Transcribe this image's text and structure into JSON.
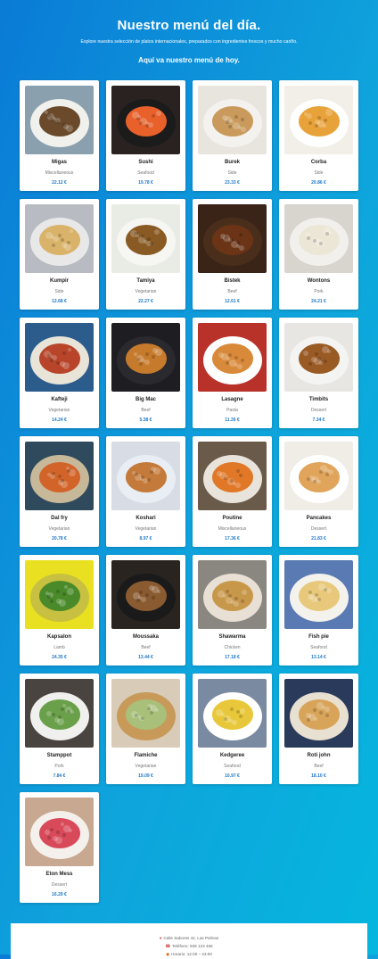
{
  "header": {
    "title": "Nuestro menú del día.",
    "subtitle": "Explore nuestra selección de platos internacionales, preparados con ingredientes frescos y mucho cariño.",
    "intro": "Aquí va nuestro menú de hoy."
  },
  "menu": [
    {
      "name": "Migas",
      "category": "Miscellaneous",
      "price": "22.12 €",
      "icon": "migas-dish-photo",
      "bg": "#8aa0ae",
      "plate": "#f0f0ec",
      "food": "#6a4a2a"
    },
    {
      "name": "Sushi",
      "category": "Seafood",
      "price": "19.78 €",
      "icon": "sushi-photo",
      "bg": "#2a2220",
      "plate": "#1b1b1b",
      "food": "#e8602a"
    },
    {
      "name": "Burek",
      "category": "Side",
      "price": "23.33 €",
      "icon": "burek-photo",
      "bg": "#e8e4de",
      "plate": "#f4f2ee",
      "food": "#c99a5c"
    },
    {
      "name": "Corba",
      "category": "Side",
      "price": "20.86 €",
      "icon": "corba-soup-photo",
      "bg": "#f2eee8",
      "plate": "#ffffff",
      "food": "#e8a23a"
    },
    {
      "name": "Kumpir",
      "category": "Side",
      "price": "12.68 €",
      "icon": "kumpir-photo",
      "bg": "#b8bcc2",
      "plate": "#e8e8e8",
      "food": "#d9b36a"
    },
    {
      "name": "Tamiya",
      "category": "Vegetarian",
      "price": "22.27 €",
      "icon": "tamiya-photo",
      "bg": "#e9ece4",
      "plate": "#f6f6f2",
      "food": "#8a5a24"
    },
    {
      "name": "Bistek",
      "category": "Beef",
      "price": "12.61 €",
      "icon": "bistek-photo",
      "bg": "#3a2418",
      "plate": "#4a2e1c",
      "food": "#6b3416"
    },
    {
      "name": "Wontons",
      "category": "Pork",
      "price": "24.21 €",
      "icon": "wontons-photo",
      "bg": "#d8d4ce",
      "plate": "#f2f0ec",
      "food": "#ece6d6"
    },
    {
      "name": "Kafteji",
      "category": "Vegetarian",
      "price": "14.24 €",
      "icon": "kafteji-photo",
      "bg": "#2b5c8c",
      "plate": "#e8e4d8",
      "food": "#b8452a"
    },
    {
      "name": "Big Mac",
      "category": "Beef",
      "price": "5.38 €",
      "icon": "big-mac-photo",
      "bg": "#1e1e22",
      "plate": "#2a2a2e",
      "food": "#c67a2c"
    },
    {
      "name": "Lasagne",
      "category": "Pasta",
      "price": "11.26 €",
      "icon": "lasagne-photo",
      "bg": "#b8322a",
      "plate": "#ffffff",
      "food": "#d88a3a"
    },
    {
      "name": "Timbits",
      "category": "Dessert",
      "price": "7.34 €",
      "icon": "timbits-photo",
      "bg": "#e8e6e2",
      "plate": "#f4f4f2",
      "food": "#9a5a24"
    },
    {
      "name": "Dal fry",
      "category": "Vegetarian",
      "price": "20.78 €",
      "icon": "dal-fry-photo",
      "bg": "#2e4a5c",
      "plate": "#c8b89a",
      "food": "#d2642a"
    },
    {
      "name": "Koshari",
      "category": "Vegetarian",
      "price": "8.97 €",
      "icon": "koshari-photo",
      "bg": "#d8dce4",
      "plate": "#e8eef4",
      "food": "#c47a3a"
    },
    {
      "name": "Poutine",
      "category": "Miscellaneous",
      "price": "17.36 €",
      "icon": "poutine-photo",
      "bg": "#6a5a4a",
      "plate": "#e8e4dc",
      "food": "#e07828"
    },
    {
      "name": "Pancakes",
      "category": "Dessert",
      "price": "21.83 €",
      "icon": "pancakes-photo",
      "bg": "#f0ece6",
      "plate": "#ffffff",
      "food": "#e0a45a"
    },
    {
      "name": "Kapsalon",
      "category": "Lamb",
      "price": "24.35 €",
      "icon": "kapsalon-photo",
      "bg": "#e8e020",
      "plate": "#c8c040",
      "food": "#4a8a2a"
    },
    {
      "name": "Moussaka",
      "category": "Beef",
      "price": "13.44 €",
      "icon": "moussaka-photo",
      "bg": "#2a2420",
      "plate": "#1a1a1a",
      "food": "#8a5a30"
    },
    {
      "name": "Shawarma",
      "category": "Chicken",
      "price": "17.18 €",
      "icon": "shawarma-photo",
      "bg": "#8a8680",
      "plate": "#e8e0d4",
      "food": "#c8984a"
    },
    {
      "name": "Fish pie",
      "category": "Seafood",
      "price": "13.14 €",
      "icon": "fish-pie-photo",
      "bg": "#5a7ab4",
      "plate": "#f4f2ec",
      "food": "#e8c87a"
    },
    {
      "name": "Stamppot",
      "category": "Pork",
      "price": "7.84 €",
      "icon": "stamppot-photo",
      "bg": "#4a4440",
      "plate": "#f0f0ee",
      "food": "#6aa04a"
    },
    {
      "name": "Flamiche",
      "category": "Vegetarian",
      "price": "19.09 €",
      "icon": "flamiche-photo",
      "bg": "#d8ccb8",
      "plate": "#c89a5a",
      "food": "#a8c07a"
    },
    {
      "name": "Kedgeree",
      "category": "Seafood",
      "price": "10.97 €",
      "icon": "kedgeree-photo",
      "bg": "#7a8aa0",
      "plate": "#ffffff",
      "food": "#e8c83a"
    },
    {
      "name": "Roti john",
      "category": "Beef",
      "price": "18.10 €",
      "icon": "roti-john-photo",
      "bg": "#2a3a5a",
      "plate": "#e8e0d0",
      "food": "#d8a45a"
    },
    {
      "name": "Eton Mess",
      "category": "Dessert",
      "price": "16.29 €",
      "icon": "eton-mess-photo",
      "bg": "#c8a890",
      "plate": "#f4f0ec",
      "food": "#d84a5a"
    }
  ],
  "footer": {
    "address": "Calle Sabores 42, Las Palmas",
    "phone": "Teléfono: 928 123 456",
    "hours": "Horario: 12:00 – 23:00"
  }
}
